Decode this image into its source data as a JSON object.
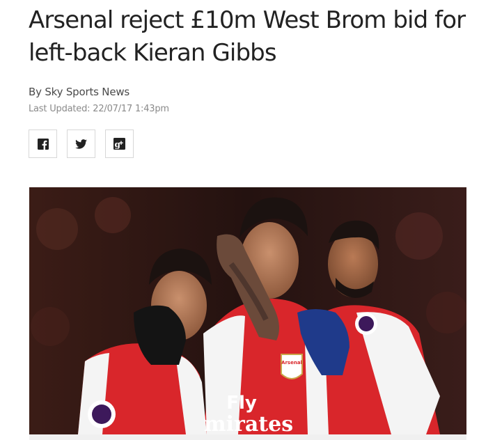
{
  "article": {
    "headline": "Arsenal reject £10m West Brom bid for left-back Kieran Gibbs",
    "byline": "By Sky Sports News",
    "last_updated": "Last Updated: 22/07/17 1:43pm"
  },
  "share": {
    "buttons": [
      {
        "icon": "facebook-icon"
      },
      {
        "icon": "twitter-icon"
      },
      {
        "icon": "google-plus-icon"
      }
    ]
  },
  "photo": {
    "sponsor_text_line1": "Fly",
    "sponsor_text_line2": "mirates",
    "crest_text": "Arsenal",
    "colors": {
      "shirt_red": "#d9262b",
      "shirt_white": "#f4f4f4",
      "background": "#2a1613",
      "glove_blue": "#1f3a8a"
    }
  }
}
